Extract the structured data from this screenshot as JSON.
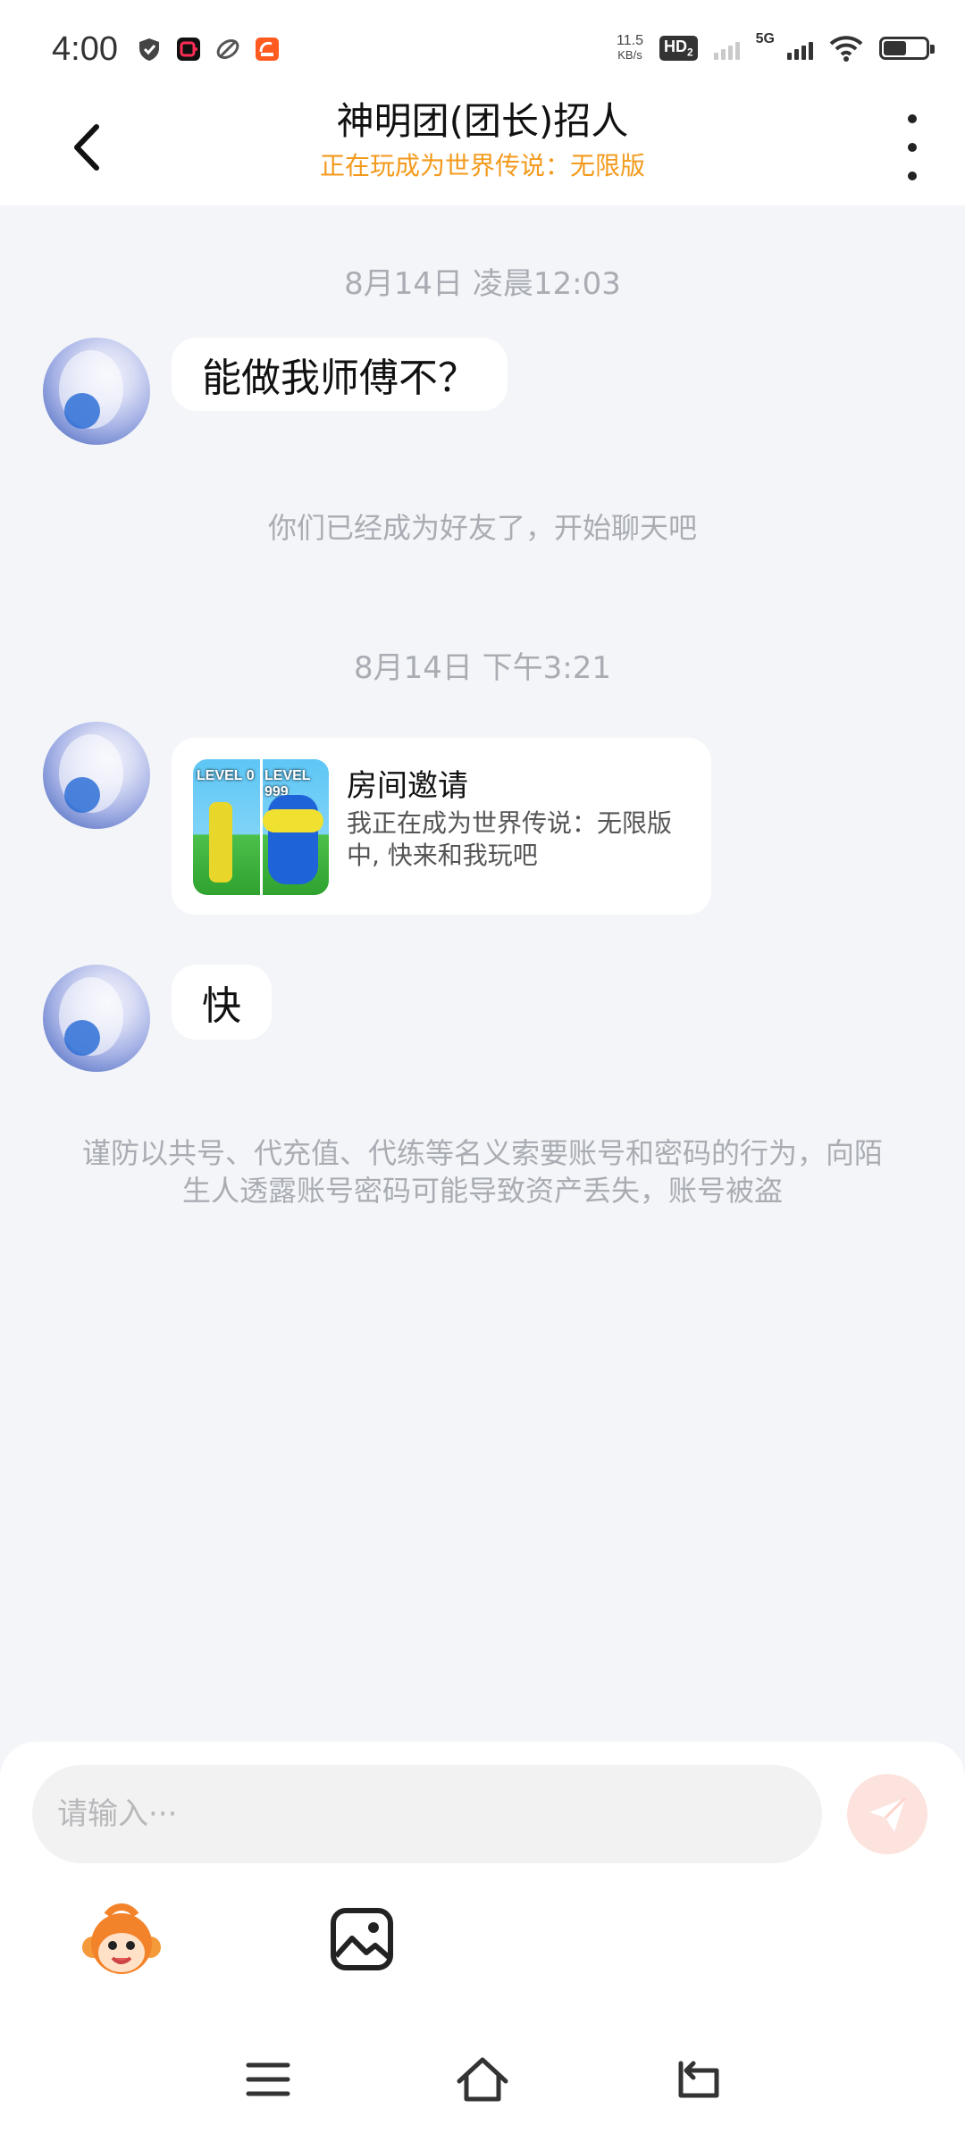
{
  "status_bar": {
    "time": "4:00",
    "speed": "11.5",
    "speed_unit": "KB/s",
    "hd_label": "HD",
    "hd_sub": "2",
    "network": "5G",
    "battery_level": 0.55
  },
  "header": {
    "title": "神明团(团长)招人",
    "subtitle": "正在玩成为世界传说：无限版"
  },
  "chat": {
    "timestamp_1": "8月14日 凌晨12:03",
    "message_1": "能做我师傅不？",
    "system_note": "你们已经成为好友了，开始聊天吧",
    "timestamp_2": "8月14日 下午3:21",
    "invite": {
      "title": "房间邀请",
      "description": "我正在成为世界传说：无限版中, 快来和我玩吧",
      "thumb_label_left": "LEVEL 0",
      "thumb_label_right": "LEVEL 999"
    },
    "message_2": "快",
    "warning": "谨防以共号、代充值、代练等名义索要账号和密码的行为，向陌生人透露账号密码可能导致资产丢失，账号被盗"
  },
  "input": {
    "placeholder": "请输入···",
    "value": ""
  },
  "colors": {
    "accent": "#f39a1c",
    "background": "#f3f5f8",
    "send_button": "#fde3de"
  },
  "icons": {
    "back": "chevron-left-icon",
    "more": "more-vertical-icon",
    "send": "send-icon",
    "emoji": "monkey-emoji-icon",
    "image": "image-icon",
    "nav_menu": "menu-icon",
    "nav_home": "home-icon",
    "nav_back": "back-icon"
  }
}
